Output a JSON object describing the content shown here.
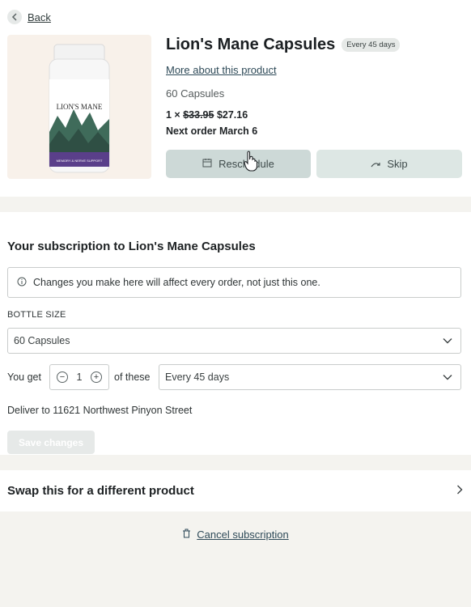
{
  "nav": {
    "back_label": "Back"
  },
  "product": {
    "name": "Lion's Mane Capsules",
    "badge": "Every 45 days",
    "more_link": "More about this product",
    "count": "60 Capsules",
    "quantity_prefix": "1 ×",
    "old_price": "$33.95",
    "new_price": "$27.16",
    "next_order": "Next order March 6",
    "image_label_line1": "LION'S MANE",
    "image_label_line2": "MEMORY & NERVE SUPPORT"
  },
  "actions": {
    "reschedule_label": "Reschedule",
    "skip_label": "Skip"
  },
  "subscription": {
    "title": "Your subscription to Lion's Mane Capsules",
    "notice": "Changes you make here will affect every order, not just this one.",
    "bottle_size_label": "BOTTLE SIZE",
    "bottle_size_value": "60 Capsules",
    "you_get_label": "You get",
    "quantity": "1",
    "of_these_label": "of these",
    "frequency_value": "Every 45 days",
    "deliver_to": "Deliver to 11621 Northwest Pinyon Street",
    "save_label": "Save changes"
  },
  "swap": {
    "title": "Swap this for a different product"
  },
  "cancel": {
    "label": "Cancel subscription"
  },
  "colors": {
    "accent_link": "#2e4a58",
    "button_primary": "#cdd9d7",
    "button_secondary": "#dde7e4",
    "page_bg": "#f4f3ef"
  }
}
